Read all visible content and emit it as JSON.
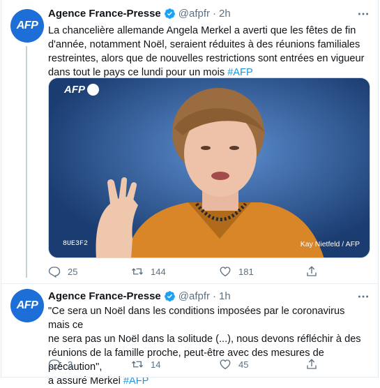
{
  "tweets": [
    {
      "avatar": {
        "label": "AFP"
      },
      "author_name": "Agence France-Presse",
      "handle": "@afpfr",
      "separator": "·",
      "time": "2h",
      "text_lines": [
        "La chancelière allemande Angela Merkel a averti que les fêtes de fin",
        "d'année, notamment Noël, seraient réduites à des réunions familiales",
        "restreintes, alors que de nouvelles restrictions sont entrées en vigueur",
        "dans tout le pays ce lundi pour un mois"
      ],
      "hashtag": "#AFP",
      "media": {
        "logo": "AFP",
        "code": "8UE3F2",
        "credit": "Kay Nietfeld / AFP"
      },
      "replies": "25",
      "retweets": "144",
      "likes": "181"
    },
    {
      "avatar": {
        "label": "AFP"
      },
      "author_name": "Agence France-Presse",
      "handle": "@afpfr",
      "separator": "·",
      "time": "1h",
      "text_lines": [
        "\"Ce sera un Noël dans les conditions imposées par le coronavirus mais ce",
        "ne sera pas un Noël dans la solitude (...), nous devons réfléchir à des",
        "réunions de la famille proche, peut-être avec des mesures de précaution\",",
        "a assuré Merkel"
      ],
      "hashtag": "#AFP",
      "replies": "3",
      "retweets": "14",
      "likes": "45"
    }
  ],
  "colors": {
    "accent": "#1b95e0",
    "avatar": "#1d6ed6",
    "secondary_text": "#5b7083",
    "verified": "#1da1f2"
  }
}
